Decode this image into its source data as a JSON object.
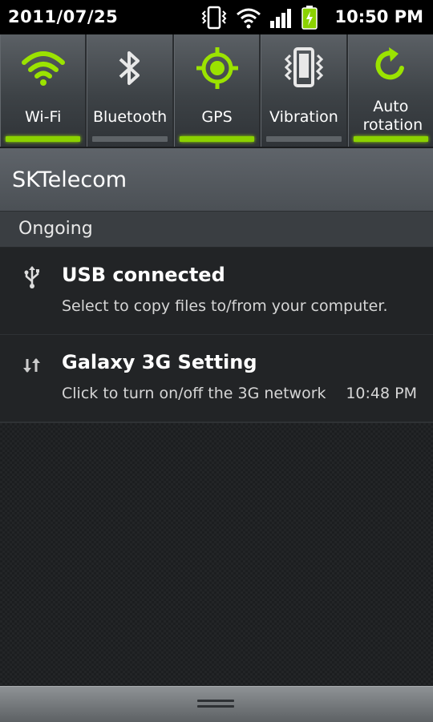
{
  "status_bar": {
    "date": "2011/07/25",
    "time": "10:50 PM",
    "icons": [
      "vibrate-icon",
      "wifi-signal-icon",
      "cell-signal-icon",
      "battery-charging-icon"
    ]
  },
  "toggles": [
    {
      "label": "Wi-Fi",
      "icon": "wifi-icon",
      "on": true
    },
    {
      "label": "Bluetooth",
      "icon": "bluetooth-icon",
      "on": false
    },
    {
      "label": "GPS",
      "icon": "gps-icon",
      "on": true
    },
    {
      "label": "Vibration",
      "icon": "vibration-icon",
      "on": false
    },
    {
      "label": "Auto rotation",
      "icon": "auto-rotation-icon",
      "on": true
    }
  ],
  "carrier": {
    "name": "SKTelecom"
  },
  "section": {
    "title": "Ongoing"
  },
  "notifications": [
    {
      "icon": "usb-icon",
      "title": "USB connected",
      "text": "Select to copy files to/from your computer.",
      "time": ""
    },
    {
      "icon": "data-transfer-icon",
      "title": "Galaxy 3G Setting",
      "text": "Click to turn on/off the 3G network",
      "time": "10:48 PM"
    }
  ],
  "colors": {
    "accent": "#8bd200",
    "off_bar": "#5e6367"
  }
}
